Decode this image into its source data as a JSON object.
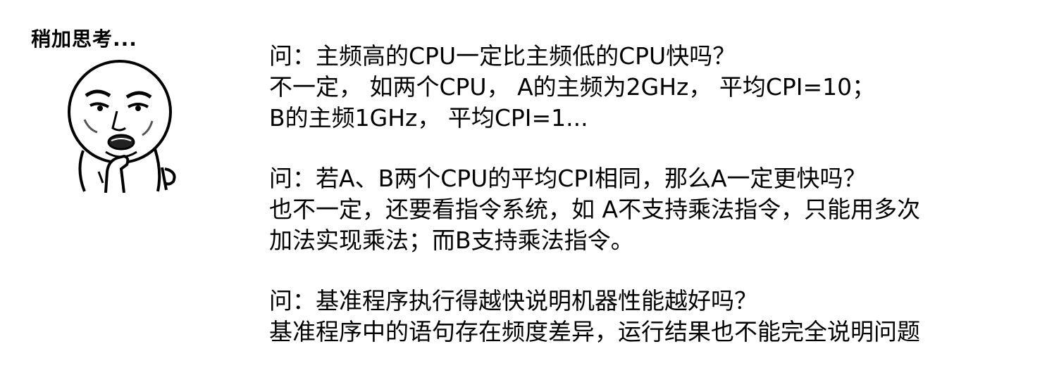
{
  "meme": {
    "caption": "稍加思考...",
    "icon": "thinking-face-meme"
  },
  "qa": [
    {
      "question": "问：主频高的CPU一定比主频低的CPU快吗？",
      "answer": [
        "不一定， 如两个CPU， A的主频为2GHz， 平均CPI=10；",
        "B的主频1GHz， 平均CPI=1..."
      ]
    },
    {
      "question": "问：若A、B两个CPU的平均CPI相同，那么A一定更快吗？",
      "answer": [
        "也不一定，还要看指令系统，如 A不支持乘法指令，只能用多次",
        "加法实现乘法；而B支持乘法指令。"
      ]
    },
    {
      "question": "问：基准程序执行得越快说明机器性能越好吗？",
      "answer": [
        "基准程序中的语句存在频度差异，运行结果也不能完全说明问题"
      ]
    }
  ]
}
